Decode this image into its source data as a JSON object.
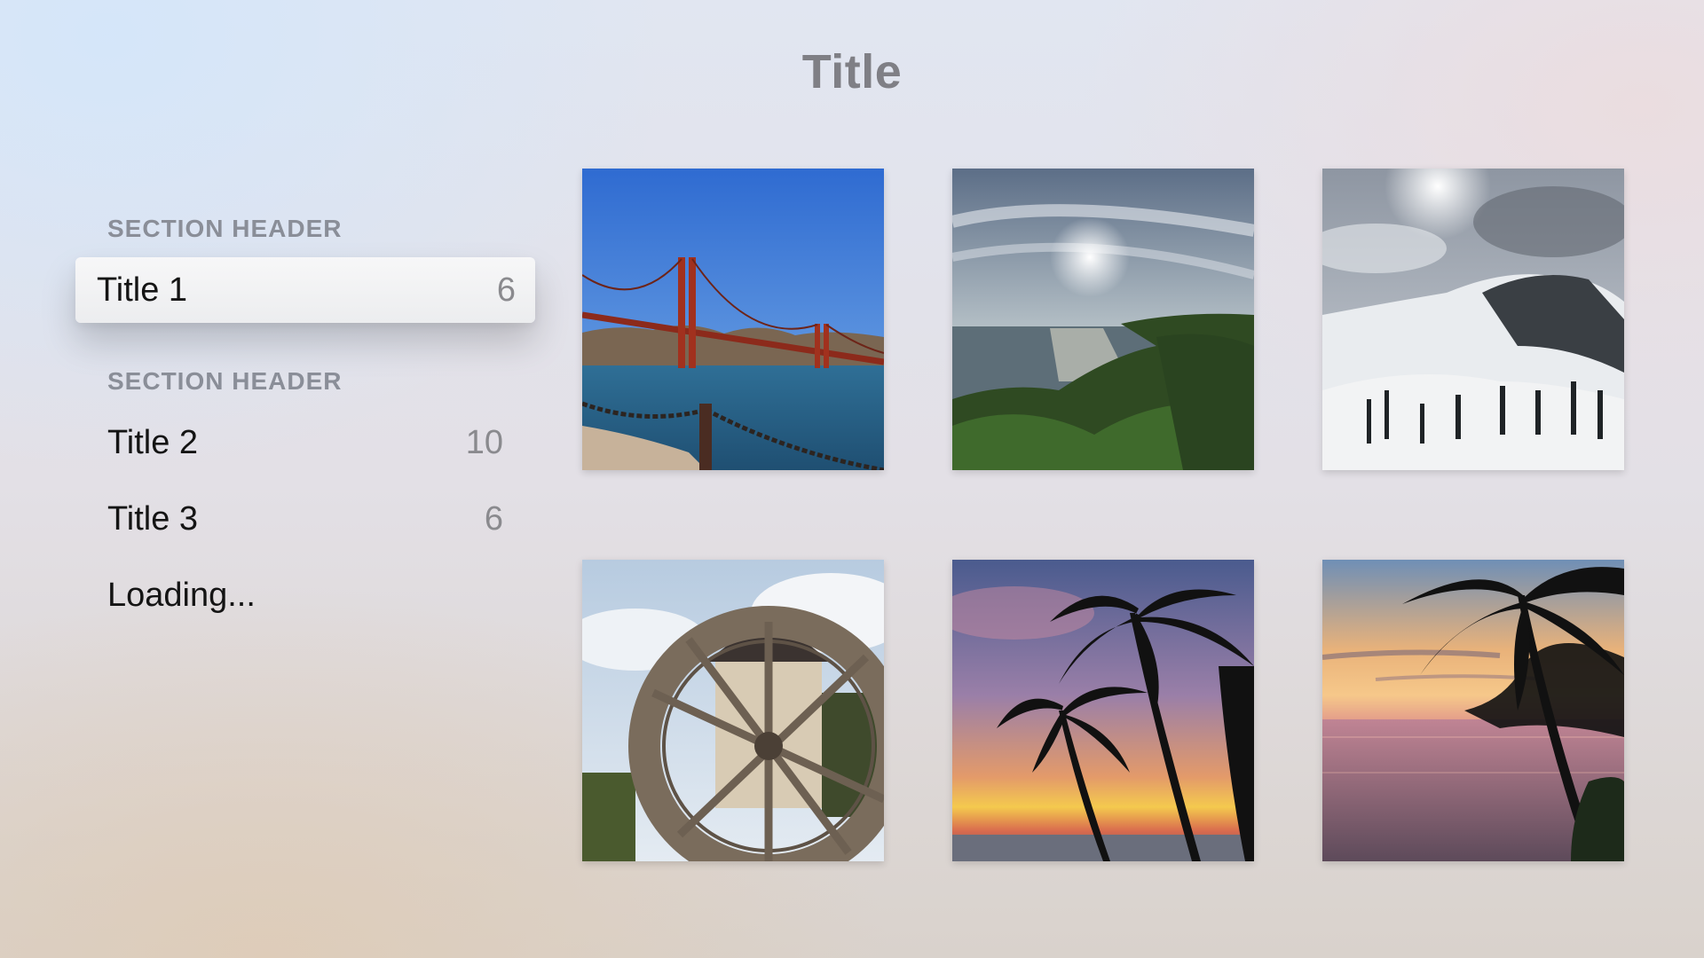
{
  "page": {
    "title": "Title"
  },
  "sidebar": {
    "sections": [
      {
        "header": "SECTION HEADER",
        "items": [
          {
            "label": "Title 1",
            "count": "6",
            "focused": true
          }
        ]
      },
      {
        "header": "SECTION HEADER",
        "items": [
          {
            "label": "Title 2",
            "count": "10"
          },
          {
            "label": "Title 3",
            "count": "6"
          },
          {
            "label": "Loading...",
            "count": ""
          }
        ]
      }
    ]
  },
  "grid": {
    "photos": [
      {
        "subject": "golden-gate-bridge-photo"
      },
      {
        "subject": "coastal-sunset-photo"
      },
      {
        "subject": "snowy-mountain-photo"
      },
      {
        "subject": "water-wheel-photo"
      },
      {
        "subject": "palm-trees-sunset-photo"
      },
      {
        "subject": "palm-tree-ocean-sunset-photo"
      }
    ]
  }
}
